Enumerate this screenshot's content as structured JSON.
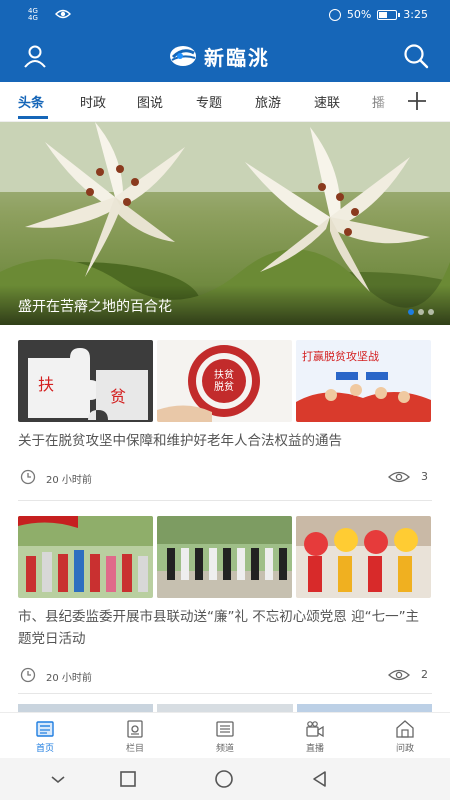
{
  "status_bar": {
    "signal": "4G\n4G",
    "battery_text": "50%",
    "time": "3:25",
    "battery_level": 0.5
  },
  "header": {
    "app_name": "新臨洮",
    "icons": [
      "user-icon",
      "search-icon"
    ]
  },
  "tabs": [
    {
      "label": "头条",
      "active": true
    },
    {
      "label": "时政",
      "active": false
    },
    {
      "label": "图说",
      "active": false
    },
    {
      "label": "专题",
      "active": false
    },
    {
      "label": "旅游",
      "active": false
    },
    {
      "label": "速联",
      "active": false
    },
    {
      "label": "播",
      "active": false
    }
  ],
  "banner": {
    "caption": "盛开在苦瘠之地的百合花",
    "slide_count": 3,
    "active_slide": 1
  },
  "articles": [
    {
      "title": "关于在脱贫攻坚中保障和维护好老年人合法权益的通告",
      "time": "20 小时前",
      "views": "3",
      "thumb_texts": [
        "扶",
        "贫",
        "扶贫\n脱贫",
        "打赢脱贫攻坚战"
      ]
    },
    {
      "title": "市、县纪委监委开展市县联动送“廉”礼 不忘初心颂党恩 迎“七一”主题党日活动",
      "time": "20 小时前",
      "views": "2"
    }
  ],
  "bottom_nav": [
    {
      "label": "首页",
      "icon": "home-news-icon",
      "active": true
    },
    {
      "label": "栏目",
      "icon": "column-icon",
      "active": false
    },
    {
      "label": "频道",
      "icon": "channel-icon",
      "active": false
    },
    {
      "label": "直播",
      "icon": "live-camera-icon",
      "active": false
    },
    {
      "label": "问政",
      "icon": "inquiry-house-icon",
      "active": false
    }
  ],
  "colors": {
    "brand_blue": "#1666b8",
    "accent_blue": "#1e7de0",
    "text_gray": "#555555"
  }
}
